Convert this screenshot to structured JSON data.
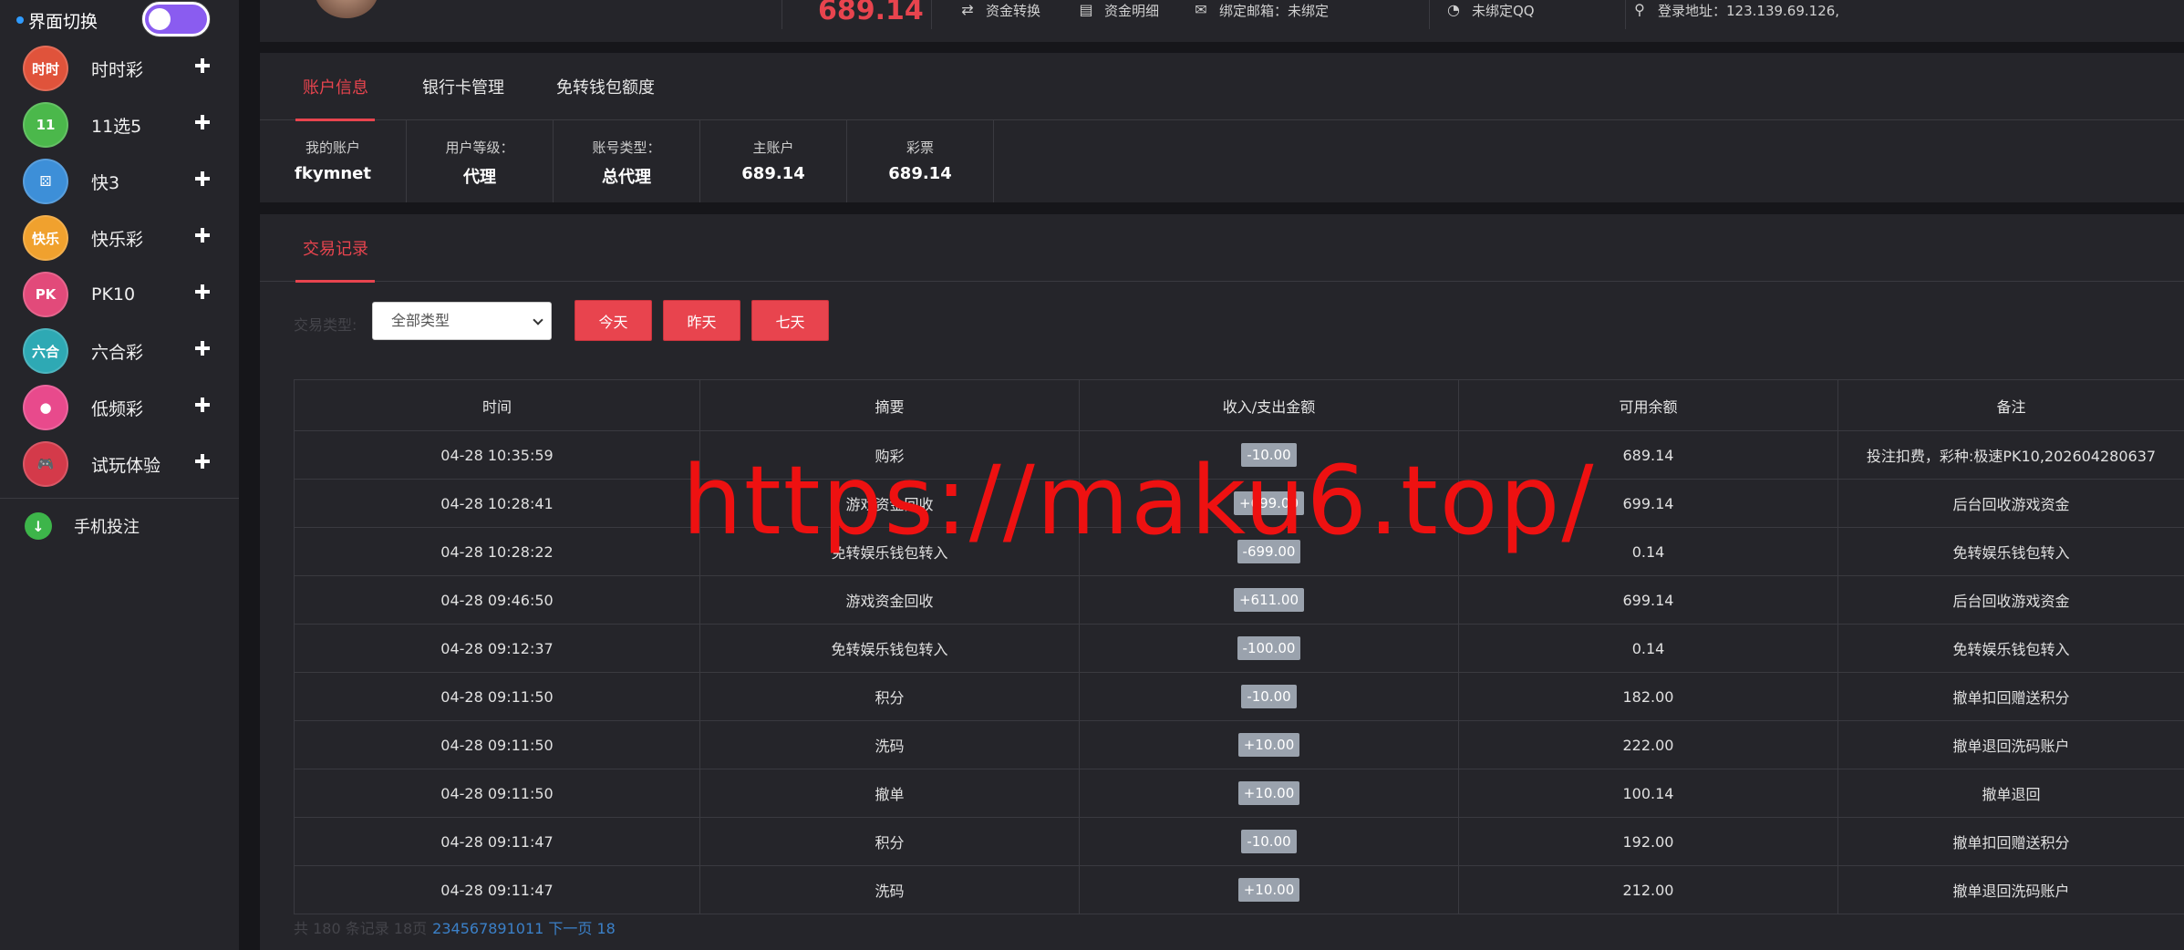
{
  "sidebar": {
    "switch_label": "界面切换",
    "items": [
      {
        "label": "时时彩",
        "icon_text": "时时",
        "icon": "shishicai-icon",
        "color": "#e0533b"
      },
      {
        "label": "11选5",
        "icon_text": "11",
        "icon": "xuan5-icon",
        "color": "#4bb84b"
      },
      {
        "label": "快3",
        "icon_text": "⚄",
        "icon": "kuai3-icon",
        "color": "#3d8fd8"
      },
      {
        "label": "快乐彩",
        "icon_text": "快乐",
        "icon": "kuailecai-icon",
        "color": "#f0a12e"
      },
      {
        "label": "PK10",
        "icon_text": "PK",
        "icon": "pk10-icon",
        "color": "#e24a7a"
      },
      {
        "label": "六合彩",
        "icon_text": "六合",
        "icon": "liuhecai-icon",
        "color": "#2ea9b4"
      },
      {
        "label": "低频彩",
        "icon_text": "●",
        "icon": "dipincai-icon",
        "color": "#e84a8c"
      },
      {
        "label": "试玩体验",
        "icon_text": "🎮",
        "icon": "gamepad-icon",
        "color": "#d43a4a"
      }
    ],
    "mobile_label": "手机投注"
  },
  "topbar": {
    "balance": "689.14",
    "links": {
      "transfer": "资金转换",
      "detail": "资金明细",
      "email": "绑定邮箱：未绑定",
      "qq": "未绑定QQ",
      "login_addr": "登录地址：123.139.69.126,"
    }
  },
  "account": {
    "tabs": [
      "账户信息",
      "银行卡管理",
      "免转钱包额度"
    ],
    "stats": [
      {
        "label": "我的账户",
        "value": "fkymnet"
      },
      {
        "label": "用户等级：",
        "value": "代理"
      },
      {
        "label": "账号类型：",
        "value": "总代理"
      },
      {
        "label": "主账户",
        "value": "689.14"
      },
      {
        "label": "彩票",
        "value": "689.14"
      }
    ]
  },
  "transactions": {
    "tab": "交易记录",
    "filter_label": "交易类型:",
    "type_selected": "全部类型",
    "buttons": {
      "today": "今天",
      "yesterday": "昨天",
      "week": "七天"
    },
    "headers": [
      "时间",
      "摘要",
      "收入/支出金额",
      "可用余额",
      "备注"
    ],
    "rows": [
      [
        "04-28 10:35:59",
        "购彩",
        "-10.00",
        "689.14",
        "投注扣费，彩种:极速PK10,202604280637"
      ],
      [
        "04-28 10:28:41",
        "游戏资金回收",
        "+699.00",
        "699.14",
        "后台回收游戏资金"
      ],
      [
        "04-28 10:28:22",
        "免转娱乐钱包转入",
        "-699.00",
        "0.14",
        "免转娱乐钱包转入"
      ],
      [
        "04-28 09:46:50",
        "游戏资金回收",
        "+611.00",
        "699.14",
        "后台回收游戏资金"
      ],
      [
        "04-28 09:12:37",
        "免转娱乐钱包转入",
        "-100.00",
        "0.14",
        "免转娱乐钱包转入"
      ],
      [
        "04-28 09:11:50",
        "积分",
        "-10.00",
        "182.00",
        "撤单扣回赠送积分"
      ],
      [
        "04-28 09:11:50",
        "洗码",
        "+10.00",
        "222.00",
        "撤单退回洗码账户"
      ],
      [
        "04-28 09:11:50",
        "撤单",
        "+10.00",
        "100.14",
        "撤单退回"
      ],
      [
        "04-28 09:11:47",
        "积分",
        "-10.00",
        "192.00",
        "撤单扣回赠送积分"
      ],
      [
        "04-28 09:11:47",
        "洗码",
        "+10.00",
        "212.00",
        "撤单退回洗码账户"
      ]
    ],
    "pagination": {
      "summary": "共 180 条记录 18页",
      "pages": "234567891011 下一页 18"
    }
  },
  "watermark": "https://maku6.top/",
  "colors": {
    "accent": "#e8444e",
    "panel": "#25252a",
    "background": "#16161a",
    "toggle": "#8a5cf0"
  }
}
